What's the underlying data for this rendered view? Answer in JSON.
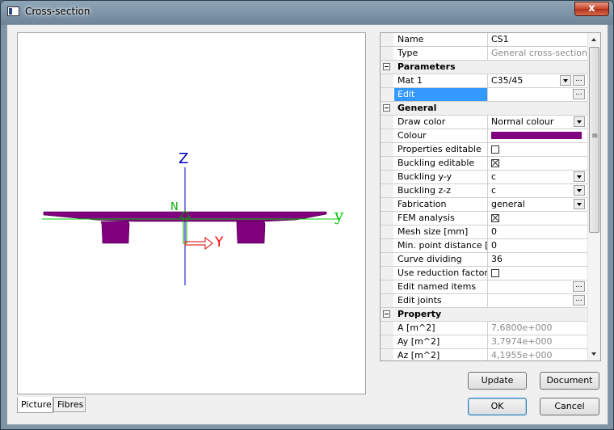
{
  "window": {
    "title": "Cross-section",
    "close_glyph": "x"
  },
  "drawing": {
    "axis_z_label": "Z",
    "axis_y_label": "y",
    "local_y_label": "Y",
    "local_z_label": "N",
    "section_color": "#800080",
    "axis_color_y": "#00cc00",
    "axis_color_z": "#0000cc",
    "local_y_color": "#ff0000",
    "local_z_color": "#00aa00"
  },
  "tabs": [
    {
      "label": "Picture",
      "active": true
    },
    {
      "label": "Fibres",
      "active": false
    }
  ],
  "properties": {
    "rows": [
      {
        "label": "Name",
        "value": "CS1"
      },
      {
        "label": "Type",
        "value": "General cross-section",
        "readonly": true
      },
      {
        "label": "Parameters",
        "section": true
      },
      {
        "label": "Mat 1",
        "value": "C35/45",
        "dropdown": true,
        "ellipsis": true
      },
      {
        "label": "Edit",
        "value": "",
        "ellipsis": true,
        "selected": true
      },
      {
        "label": "General",
        "section": true
      },
      {
        "label": "Draw color",
        "value": "Normal colour",
        "dropdown": true
      },
      {
        "label": "Colour",
        "swatch": "#800080"
      },
      {
        "label": "Properties editable",
        "checkbox": false
      },
      {
        "label": "Buckling editable",
        "checkbox": true
      },
      {
        "label": "Buckling y-y",
        "value": "c",
        "dropdown": true
      },
      {
        "label": "Buckling z-z",
        "value": "c",
        "dropdown": true
      },
      {
        "label": "Fabrication",
        "value": "general",
        "dropdown": true
      },
      {
        "label": "FEM analysis",
        "checkbox": true
      },
      {
        "label": "Mesh size [mm]",
        "value": "0"
      },
      {
        "label": "Min. point distance [...",
        "value": "0"
      },
      {
        "label": "Curve dividing",
        "value": "36"
      },
      {
        "label": "Use reduction factors",
        "checkbox": false
      },
      {
        "label": "Edit named items",
        "value": "",
        "ellipsis": true
      },
      {
        "label": "Edit joints",
        "value": "",
        "ellipsis": true
      },
      {
        "label": "Property",
        "section": true
      },
      {
        "label": "A [m^2]",
        "value": "7,6800e+000",
        "readonly": true
      },
      {
        "label": "Ay [m^2]",
        "value": "3,7974e+000",
        "readonly": true
      },
      {
        "label": "Az [m^2]",
        "value": "4,1955e+000",
        "readonly": true
      }
    ]
  },
  "buttons": {
    "update": "Update",
    "document": "Document",
    "ok": "OK",
    "cancel": "Cancel"
  }
}
